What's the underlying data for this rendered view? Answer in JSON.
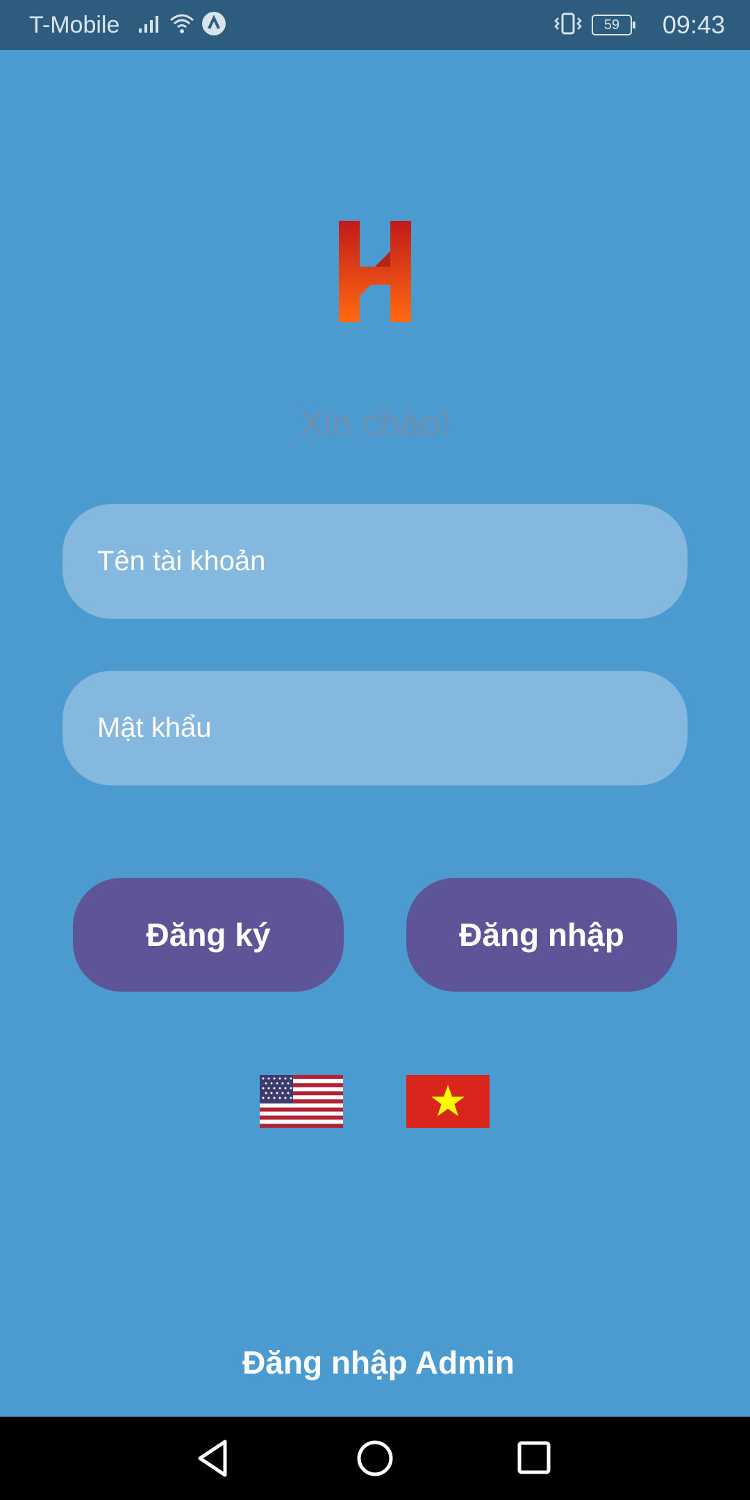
{
  "status_bar": {
    "carrier": "T-Mobile",
    "battery_level": "59",
    "time": "09:43",
    "icons": [
      "signal-icon",
      "wifi-icon",
      "app-notification-icon",
      "vibrate-icon",
      "battery-icon"
    ]
  },
  "login": {
    "greeting": "Xin chào!",
    "username_placeholder": "Tên tài khoản",
    "password_placeholder": "Mật khẩu",
    "register_label": "Đăng ký",
    "login_label": "Đăng nhập",
    "admin_login_label": "Đăng nhập Admin"
  },
  "languages": [
    "english-flag-icon",
    "vietnamese-flag-icon"
  ],
  "nav_bar": {
    "buttons": [
      "back-icon",
      "home-icon",
      "recent-apps-icon"
    ]
  },
  "colors": {
    "background": "#4b9ad0",
    "status_bar": "#2e5c7e",
    "input_fill": "#84b8de",
    "button_fill": "#5e5498",
    "greeting_text": "#6d8fb0"
  }
}
